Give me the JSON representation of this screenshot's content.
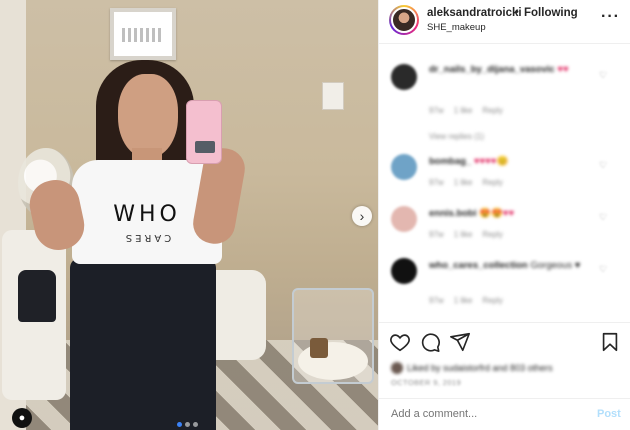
{
  "post": {
    "shirt_text_top": "WHO",
    "shirt_text_bottom": "CARES"
  },
  "header": {
    "username": "aleksandratroicki",
    "separator": "•",
    "follow_state": "Following",
    "location": "SHE_makeup",
    "more_icon": "more-horizontal-icon",
    "more_glyph": "···"
  },
  "comments": [
    {
      "user": "dr_nails_by_dijana_vasovic",
      "text": "♥♥",
      "time": "97w",
      "likes": "1 like",
      "reply": "Reply",
      "replies_label": "View replies (1)",
      "avatar_color": "#2a2a2a"
    },
    {
      "user": "bombag_",
      "text": "♥♥♥♥😊",
      "time": "97w",
      "likes": "1 like",
      "reply": "Reply",
      "avatar_color": "#6fa3c7"
    },
    {
      "user": "ennis.bobi",
      "text": "😍😍♥♥",
      "time": "97w",
      "likes": "1 like",
      "reply": "Reply",
      "avatar_color": "#e3b7b0"
    },
    {
      "user": "who_cares_collection",
      "text": "Gorgeous ♥",
      "time": "97w",
      "likes": "1 like",
      "reply": "Reply",
      "avatar_color": "#111111"
    }
  ],
  "actions": {
    "like_icon": "heart-icon",
    "comment_icon": "comment-icon",
    "share_icon": "share-icon",
    "save_icon": "bookmark-icon"
  },
  "likes_text": "Liked by sudaistorfrd and 803 others",
  "date_text": "OCTOBER 9, 2019",
  "add_comment": {
    "placeholder": "Add a comment...",
    "post_label": "Post"
  },
  "carousel": {
    "next_glyph": "›",
    "user_tag_glyph": "●"
  }
}
